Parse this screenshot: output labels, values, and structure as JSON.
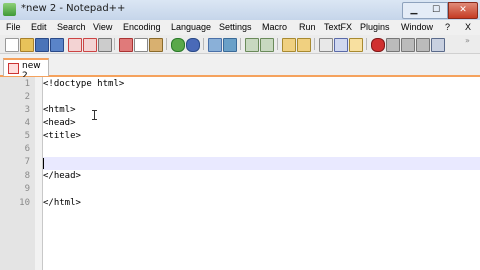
{
  "window": {
    "title": "*new  2 - Notepad++"
  },
  "title_controls": {
    "close_label": "✕"
  },
  "menu": [
    "File",
    "Edit",
    "Search",
    "View",
    "Encoding",
    "Language",
    "Settings",
    "Macro",
    "Run",
    "TextFX",
    "Plugins",
    "Window",
    "?",
    "X"
  ],
  "toolbar_icons": [
    "new-file-icon",
    "open-folder-icon",
    "save-icon",
    "save-all-icon",
    "close-icon",
    "close-all-icon",
    "print-icon",
    "cut-icon",
    "copy-icon",
    "paste-icon",
    "undo-icon",
    "redo-icon",
    "find-icon",
    "replace-icon",
    "zoom-in-icon",
    "zoom-out-icon",
    "sync-v-icon",
    "sync-h-icon",
    "word-wrap-icon",
    "all-chars-icon",
    "indent-guide-icon",
    "record-macro-icon"
  ],
  "tabs": [
    {
      "label": "new  2",
      "active": true
    }
  ],
  "editor": {
    "lines": [
      {
        "num": "1",
        "text": "<!doctype html>"
      },
      {
        "num": "2",
        "text": ""
      },
      {
        "num": "3",
        "text": "<html>"
      },
      {
        "num": "4",
        "text": "<head>"
      },
      {
        "num": "5",
        "text": "<title>"
      },
      {
        "num": "6",
        "text": ""
      },
      {
        "num": "7",
        "text": ""
      },
      {
        "num": "8",
        "text": "</head>"
      },
      {
        "num": "9",
        "text": ""
      },
      {
        "num": "10",
        "text": "</html>"
      }
    ],
    "current_line": 7
  },
  "colors": {
    "accent": "#f5a25d",
    "current_line_bg": "#e9e9ff",
    "gutter_bg": "#e4e4e4"
  }
}
